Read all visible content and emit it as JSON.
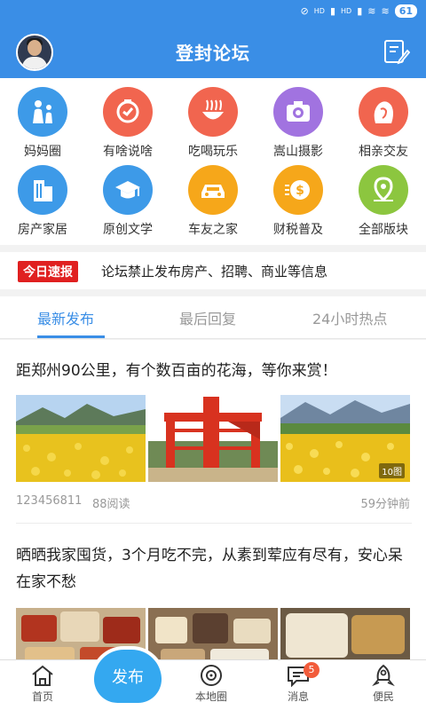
{
  "status_bar": {
    "battery": "61",
    "network_1": "HD",
    "network_2": "HD"
  },
  "header": {
    "title": "登封论坛"
  },
  "categories": [
    {
      "label": "妈妈圈",
      "icon": "family-icon",
      "color": "#3d9ae8"
    },
    {
      "label": "有啥说啥",
      "icon": "chat-clock-icon",
      "color": "#f1654f"
    },
    {
      "label": "吃喝玩乐",
      "icon": "noodle-bowl-icon",
      "color": "#f1654f"
    },
    {
      "label": "嵩山摄影",
      "icon": "camera-icon",
      "color": "#a173e0"
    },
    {
      "label": "相亲交友",
      "icon": "woman-profile-icon",
      "color": "#f1654f"
    },
    {
      "label": "房产家居",
      "icon": "building-icon",
      "color": "#3d9ae8"
    },
    {
      "label": "原创文学",
      "icon": "graduation-cap-icon",
      "color": "#3d9ae8"
    },
    {
      "label": "车友之家",
      "icon": "car-icon",
      "color": "#f6a71a"
    },
    {
      "label": "财税普及",
      "icon": "coin-icon",
      "color": "#f6a71a"
    },
    {
      "label": "全部版块",
      "icon": "location-pin-icon",
      "color": "#8cc63f"
    }
  ],
  "notice": {
    "tag": "今日速报",
    "text": "论坛禁止发布房产、招聘、商业等信息"
  },
  "tabs": [
    {
      "label": "最新发布"
    },
    {
      "label": "最后回复"
    },
    {
      "label": "24小时热点"
    }
  ],
  "posts": [
    {
      "title": "距郑州90公里，有个数百亩的花海，等你来赏！",
      "author": "123456811",
      "reads": "88阅读",
      "time": "59分钟前",
      "image_count": "10图"
    },
    {
      "title": "晒晒我家囤货，3个月吃不完，从素到荤应有尽有，安心呆在家不愁"
    }
  ],
  "bottom_nav": [
    {
      "label": "首页",
      "icon": "home-icon"
    },
    {
      "label": "发布",
      "icon": "publish-button"
    },
    {
      "label": "本地圈",
      "icon": "local-circle-icon"
    },
    {
      "label": "消息",
      "icon": "message-icon",
      "badge": "5"
    },
    {
      "label": "便民",
      "icon": "rocket-icon"
    }
  ],
  "colors": {
    "primary": "#3a8ee6",
    "publish": "#34a8f0",
    "notice_red": "#e02020",
    "badge": "#f25c3b"
  }
}
